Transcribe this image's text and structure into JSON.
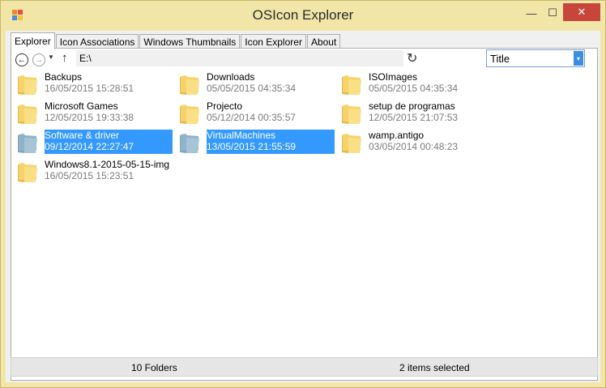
{
  "window": {
    "title": "OSIcon Explorer",
    "controls": {
      "minimize": "—",
      "maximize": "☐",
      "close": "✕"
    }
  },
  "tabs": [
    {
      "label": "Explorer",
      "active": true
    },
    {
      "label": "Icon Associations",
      "active": false
    },
    {
      "label": "Windows Thumbnails",
      "active": false
    },
    {
      "label": "Icon Explorer",
      "active": false
    },
    {
      "label": "About",
      "active": false
    }
  ],
  "toolbar": {
    "back_icon": "←",
    "forward_icon": "→",
    "dropdown_icon": "▼",
    "up_icon": "↑",
    "address": "E:\\",
    "refresh_icon": "↻",
    "sort_value": "Title",
    "sort_arrow": "▾"
  },
  "items": [
    {
      "name": "Backups",
      "date": "16/05/2015 15:28:51",
      "selected": false
    },
    {
      "name": "Downloads",
      "date": "05/05/2015 04:35:34",
      "selected": false
    },
    {
      "name": "ISOImages",
      "date": "05/05/2015 04:35:34",
      "selected": false
    },
    {
      "name": "Microsoft Games",
      "date": "12/05/2015 19:33:38",
      "selected": false
    },
    {
      "name": "Projecto",
      "date": "05/12/2014 00:35:57",
      "selected": false
    },
    {
      "name": "setup de programas",
      "date": "12/05/2015 21:07:53",
      "selected": false
    },
    {
      "name": "Software & driver",
      "date": "09/12/2014 22:27:47",
      "selected": true
    },
    {
      "name": "VirtualMachines",
      "date": "13/05/2015 21:55:59",
      "selected": true
    },
    {
      "name": "wamp.antigo",
      "date": "03/05/2014 00:48:23",
      "selected": false
    },
    {
      "name": "Windows8.1-2015-05-15-img",
      "date": "16/05/2015 15:23:51",
      "selected": false
    }
  ],
  "status": {
    "folders": "10 Folders",
    "selection": "2 items selected"
  },
  "colors": {
    "window_frame": "#f1e6a8",
    "selection": "#3399ff",
    "close_button": "#c7453a",
    "folder": "#f6d36a"
  }
}
